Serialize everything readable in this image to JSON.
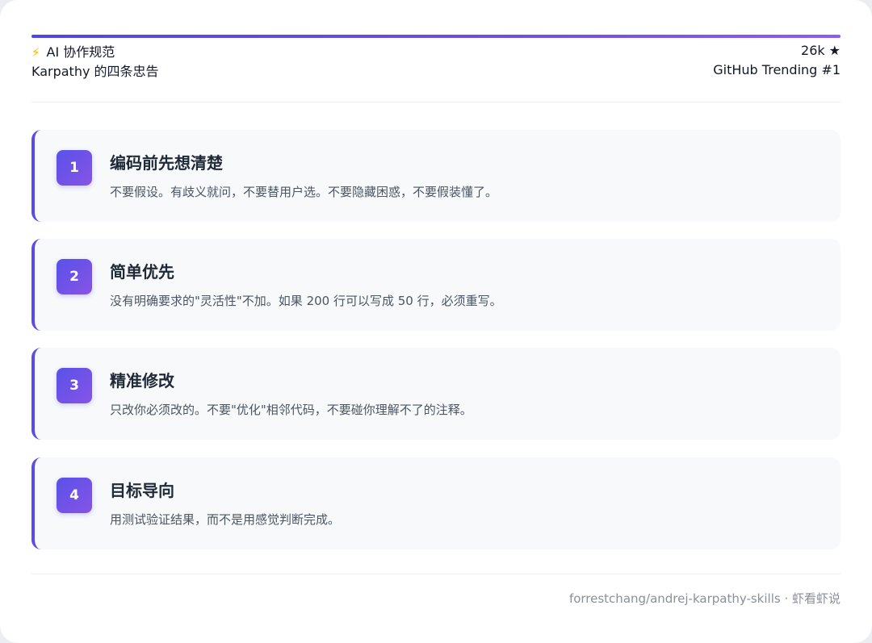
{
  "header": {
    "category_icon": "lightning-bolt",
    "category": "AI 协作规范",
    "subtitle": "Karpathy 的四条忠告",
    "stars": "26k",
    "star_icon": "★",
    "badge": "GitHub Trending #1"
  },
  "accent_color": "#5b4be6",
  "rules": [
    {
      "num": "1",
      "title": "编码前先想清楚",
      "desc": "不要假设。有歧义就问，不要替用户选。不要隐藏困惑，不要假装懂了。"
    },
    {
      "num": "2",
      "title": "简单优先",
      "desc": "没有明确要求的\"灵活性\"不加。如果 200 行可以写成 50 行，必须重写。"
    },
    {
      "num": "3",
      "title": "精准修改",
      "desc": "只改你必须改的。不要\"优化\"相邻代码，不要碰你理解不了的注释。"
    },
    {
      "num": "4",
      "title": "目标导向",
      "desc": "用测试验证结果，而不是用感觉判断完成。"
    }
  ],
  "footer": "forrestchang/andrej-karpathy-skills · 虾看虾说"
}
